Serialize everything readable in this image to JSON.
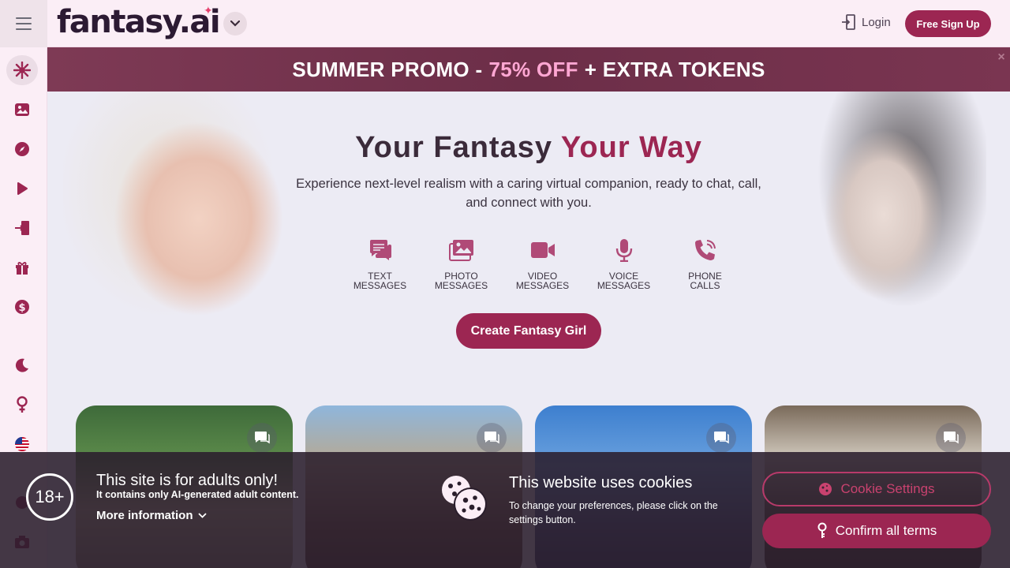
{
  "brand": {
    "logo_text": "fantasy.ai",
    "accent_color": "#9c2652",
    "dropdown_icon": "chevron-down-icon"
  },
  "header": {
    "menu_icon": "hamburger-icon",
    "login_label": "Login",
    "login_icon": "login-icon",
    "signup_label": "Free Sign Up"
  },
  "sidebar": {
    "items": [
      {
        "icon": "sparkle-burst-icon",
        "active": true
      },
      {
        "icon": "gallery-icon"
      },
      {
        "icon": "compass-icon"
      },
      {
        "icon": "play-icon"
      },
      {
        "icon": "login-door-icon"
      },
      {
        "icon": "gift-icon"
      },
      {
        "icon": "dollar-icon"
      },
      {
        "icon": "moon-icon"
      },
      {
        "icon": "female-symbol-icon"
      },
      {
        "icon": "us-flag-icon"
      },
      {
        "icon": "globe-icon"
      },
      {
        "icon": "camera-icon"
      }
    ]
  },
  "promo": {
    "part1": "SUMMER PROMO -",
    "highlight": "75% OFF",
    "part2": "+ EXTRA TOKENS",
    "close_label": "×"
  },
  "hero": {
    "title_part1": "Your Fantasy",
    "title_part2": "Your Way",
    "subtitle": "Experience next-level realism with a caring virtual companion, ready to chat, call, and connect with you.",
    "features": [
      {
        "icon": "text-messages-icon",
        "label": "TEXT\nMESSAGES"
      },
      {
        "icon": "photo-messages-icon",
        "label": "PHOTO\nMESSAGES"
      },
      {
        "icon": "video-messages-icon",
        "label": "VIDEO\nMESSAGES"
      },
      {
        "icon": "microphone-icon",
        "label": "VOICE\nMESSAGES"
      },
      {
        "icon": "phone-icon",
        "label": "PHONE\nCALLS"
      }
    ],
    "cta_label": "Create Fantasy Girl"
  },
  "cards": [
    {
      "chat_icon": "chat-bubble-icon"
    },
    {
      "chat_icon": "chat-bubble-icon"
    },
    {
      "chat_icon": "chat-bubble-icon"
    },
    {
      "chat_icon": "chat-bubble-icon"
    }
  ],
  "cookie_bar": {
    "age_badge": "18+",
    "adult_title": "This site is for adults only!",
    "adult_text": "It contains only AI-generated adult content.",
    "more_info_label": "More information",
    "cookie_title": "This website uses cookies",
    "cookie_text": "To change your preferences, please click on the settings button.",
    "settings_label": "Cookie Settings",
    "confirm_label": "Confirm all terms"
  }
}
